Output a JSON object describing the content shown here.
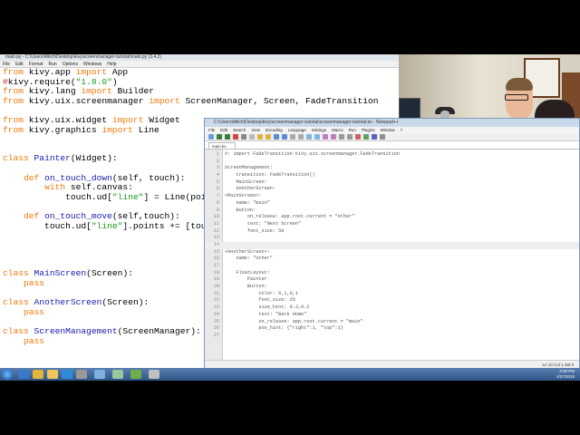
{
  "idle": {
    "title": "main.py - C:\\Users\\Mitch\\Desktop\\kivy\\screenmanager-tutorial\\main.py (3.4.2)",
    "menu": [
      "File",
      "Edit",
      "Format",
      "Run",
      "Options",
      "Windows",
      "Help"
    ],
    "code_lines": [
      [
        {
          "t": "from",
          "c": "k"
        },
        {
          "t": " kivy.app ",
          "c": ""
        },
        {
          "t": "import",
          "c": "k"
        },
        {
          "t": " App",
          "c": ""
        }
      ],
      [
        {
          "t": "#",
          "c": "c"
        },
        {
          "t": "kivy.require(",
          "c": ""
        },
        {
          "t": "\"1.8.0\"",
          "c": "s"
        },
        {
          "t": ")",
          "c": ""
        }
      ],
      [
        {
          "t": "from",
          "c": "k"
        },
        {
          "t": " kivy.lang ",
          "c": ""
        },
        {
          "t": "import",
          "c": "k"
        },
        {
          "t": " Builder",
          "c": ""
        }
      ],
      [
        {
          "t": "from",
          "c": "k"
        },
        {
          "t": " kivy.uix.screenmanager ",
          "c": ""
        },
        {
          "t": "import",
          "c": "k"
        },
        {
          "t": " ScreenManager, Screen, FadeTransition",
          "c": ""
        }
      ],
      [
        {
          "t": "",
          "c": ""
        }
      ],
      [
        {
          "t": "from",
          "c": "k"
        },
        {
          "t": " kivy.uix.widget ",
          "c": ""
        },
        {
          "t": "import",
          "c": "k"
        },
        {
          "t": " Widget",
          "c": ""
        }
      ],
      [
        {
          "t": "from",
          "c": "k"
        },
        {
          "t": " kivy.graphics ",
          "c": ""
        },
        {
          "t": "import",
          "c": "k"
        },
        {
          "t": " Line",
          "c": ""
        }
      ],
      [
        {
          "t": "",
          "c": ""
        }
      ],
      [
        {
          "t": "",
          "c": ""
        }
      ],
      [
        {
          "t": "class",
          "c": "k"
        },
        {
          "t": " Painter",
          "c": "n"
        },
        {
          "t": "(Widget):",
          "c": ""
        }
      ],
      [
        {
          "t": "",
          "c": ""
        }
      ],
      [
        {
          "t": "    ",
          "c": ""
        },
        {
          "t": "def",
          "c": "k"
        },
        {
          "t": " on_touch_down",
          "c": "n"
        },
        {
          "t": "(self, touch):",
          "c": ""
        }
      ],
      [
        {
          "t": "        ",
          "c": ""
        },
        {
          "t": "with",
          "c": "k"
        },
        {
          "t": " self.canvas:",
          "c": ""
        }
      ],
      [
        {
          "t": "            touch.ud[",
          "c": ""
        },
        {
          "t": "\"line\"",
          "c": "s"
        },
        {
          "t": "] = Line(points=(touch.x, touch.y))",
          "c": ""
        }
      ],
      [
        {
          "t": "",
          "c": ""
        }
      ],
      [
        {
          "t": "    ",
          "c": ""
        },
        {
          "t": "def",
          "c": "k"
        },
        {
          "t": " on_touch_move",
          "c": "n"
        },
        {
          "t": "(self,touch):",
          "c": ""
        }
      ],
      [
        {
          "t": "        touch.ud[",
          "c": ""
        },
        {
          "t": "\"line\"",
          "c": "s"
        },
        {
          "t": "].points += [touch.x, touch.y]",
          "c": ""
        }
      ],
      [
        {
          "t": "",
          "c": ""
        }
      ],
      [
        {
          "t": "",
          "c": ""
        }
      ],
      [
        {
          "t": "",
          "c": ""
        }
      ],
      [
        {
          "t": "",
          "c": ""
        }
      ],
      [
        {
          "t": "class",
          "c": "k"
        },
        {
          "t": " MainScreen",
          "c": "n"
        },
        {
          "t": "(Screen):",
          "c": ""
        }
      ],
      [
        {
          "t": "    ",
          "c": ""
        },
        {
          "t": "pass",
          "c": "k"
        }
      ],
      [
        {
          "t": "",
          "c": ""
        }
      ],
      [
        {
          "t": "class",
          "c": "k"
        },
        {
          "t": " AnotherScreen",
          "c": "n"
        },
        {
          "t": "(Screen):",
          "c": ""
        }
      ],
      [
        {
          "t": "    ",
          "c": ""
        },
        {
          "t": "pass",
          "c": "k"
        }
      ],
      [
        {
          "t": "",
          "c": ""
        }
      ],
      [
        {
          "t": "class",
          "c": "k"
        },
        {
          "t": " ScreenManagement",
          "c": "n"
        },
        {
          "t": "(ScreenManager):",
          "c": ""
        }
      ],
      [
        {
          "t": "    ",
          "c": ""
        },
        {
          "t": "pass",
          "c": "k"
        }
      ]
    ]
  },
  "npp": {
    "title": "C:\\Users\\Mitch\\Desktop\\kivy\\screenmanager-tutorial\\screenmanager-tutorial.kv - Notepad++",
    "menu": [
      "File",
      "Edit",
      "Search",
      "View",
      "Encoding",
      "Language",
      "Settings",
      "Macro",
      "Run",
      "Plugins",
      "Window",
      "?"
    ],
    "tab": "main.kv",
    "status": "Ln 10 Col 1 Sel 0",
    "lines": [
      {
        "n": "1",
        "t": "#: import FadeTransition kivy.uix.screenmanager.FadeTransition"
      },
      {
        "n": "2",
        "t": ""
      },
      {
        "n": "3",
        "t": "ScreenManagement:"
      },
      {
        "n": "4",
        "t": "    transition: FadeTransition()"
      },
      {
        "n": "5",
        "t": "    MainScreen:"
      },
      {
        "n": "6",
        "t": "    AnotherScreen:"
      },
      {
        "n": "7",
        "t": "<MainScreen>:"
      },
      {
        "n": "8",
        "t": "    name: \"main\""
      },
      {
        "n": "9",
        "t": "    Button:"
      },
      {
        "n": "10",
        "t": "        on_release: app.root.current = \"other\""
      },
      {
        "n": "11",
        "t": "        text: \"Next Screen\""
      },
      {
        "n": "12",
        "t": "        font_size: 50"
      },
      {
        "n": "13",
        "t": ""
      },
      {
        "n": "14",
        "t": ""
      },
      {
        "n": "15",
        "t": "<AnotherScreen>:"
      },
      {
        "n": "16",
        "t": "    name: \"other\""
      },
      {
        "n": "17",
        "t": ""
      },
      {
        "n": "18",
        "t": "    FloatLayout:"
      },
      {
        "n": "19",
        "t": "        Painter"
      },
      {
        "n": "20",
        "t": "        Button:"
      },
      {
        "n": "21",
        "t": "            color: 0,1,0,1"
      },
      {
        "n": "22",
        "t": "            font_size: 25"
      },
      {
        "n": "23",
        "t": "            size_hint: 0.3,0.2"
      },
      {
        "n": "24",
        "t": "            text: \"Back Home\""
      },
      {
        "n": "25",
        "t": "            on_release: app.root.current = \"main\""
      },
      {
        "n": "26",
        "t": "            pos_hint: {\"right\":1, \"top\":1}"
      },
      {
        "n": "27",
        "t": ""
      }
    ]
  },
  "taskbar": {
    "time": "3:38 PM",
    "date": "1/27/2015"
  }
}
